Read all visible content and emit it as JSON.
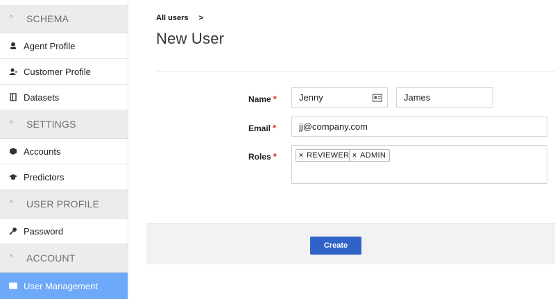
{
  "sidebar": {
    "sections": [
      {
        "title": "SCHEMA",
        "items": [
          {
            "label": "Agent Profile",
            "icon": "agent-icon"
          },
          {
            "label": "Customer Profile",
            "icon": "customer-icon"
          },
          {
            "label": "Datasets",
            "icon": "dataset-icon"
          }
        ]
      },
      {
        "title": "SETTINGS",
        "items": [
          {
            "label": "Accounts",
            "icon": "cube-icon"
          },
          {
            "label": "Predictors",
            "icon": "graduation-cap-icon"
          }
        ]
      },
      {
        "title": "USER PROFILE",
        "items": [
          {
            "label": "Password",
            "icon": "key-icon"
          }
        ]
      },
      {
        "title": "ACCOUNT",
        "items": [
          {
            "label": "User Management",
            "icon": "id-card-icon",
            "active": true
          }
        ]
      }
    ],
    "active_color": "#6ea8f8"
  },
  "breadcrumb": {
    "link": "All users",
    "separator": ">"
  },
  "page_title": "New User",
  "form": {
    "name_label": "Name",
    "email_label": "Email",
    "roles_label": "Roles",
    "required_marker": "*",
    "first_name_value": "Jenny",
    "last_name_value": "James",
    "email_value": "jj@company.com",
    "roles": [
      "REVIEWER",
      "ADMIN"
    ],
    "remove_marker": "×"
  },
  "actions": {
    "create_label": "Create",
    "create_color": "#2f63c8"
  }
}
